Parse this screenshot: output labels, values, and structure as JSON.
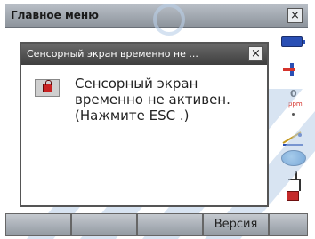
{
  "window": {
    "title": "Главное меню",
    "close_glyph": "×"
  },
  "dialog": {
    "title": "Сенсорный экран временно не ...",
    "close_glyph": "×",
    "icon": "touch-lock-icon",
    "message_lines": [
      "Сенсорный экран",
      "временно не активен.",
      "(Нажмите ESC .)"
    ]
  },
  "status_icons": {
    "battery": "battery-icon",
    "prism_offset": "prism-offset-icon",
    "ppm_value": "0",
    "ppm_unit": "ppm",
    "tilt": "tilt-icon",
    "laser_target": "target-icon",
    "step": "step-icon",
    "lock": "lock-icon"
  },
  "softkeys": [
    "",
    "",
    "",
    "Версия",
    ""
  ],
  "colors": {
    "accent_blue": "#2a4fb4",
    "lock_red": "#c82222",
    "dialog_title_bg": "#4a4a4a"
  }
}
